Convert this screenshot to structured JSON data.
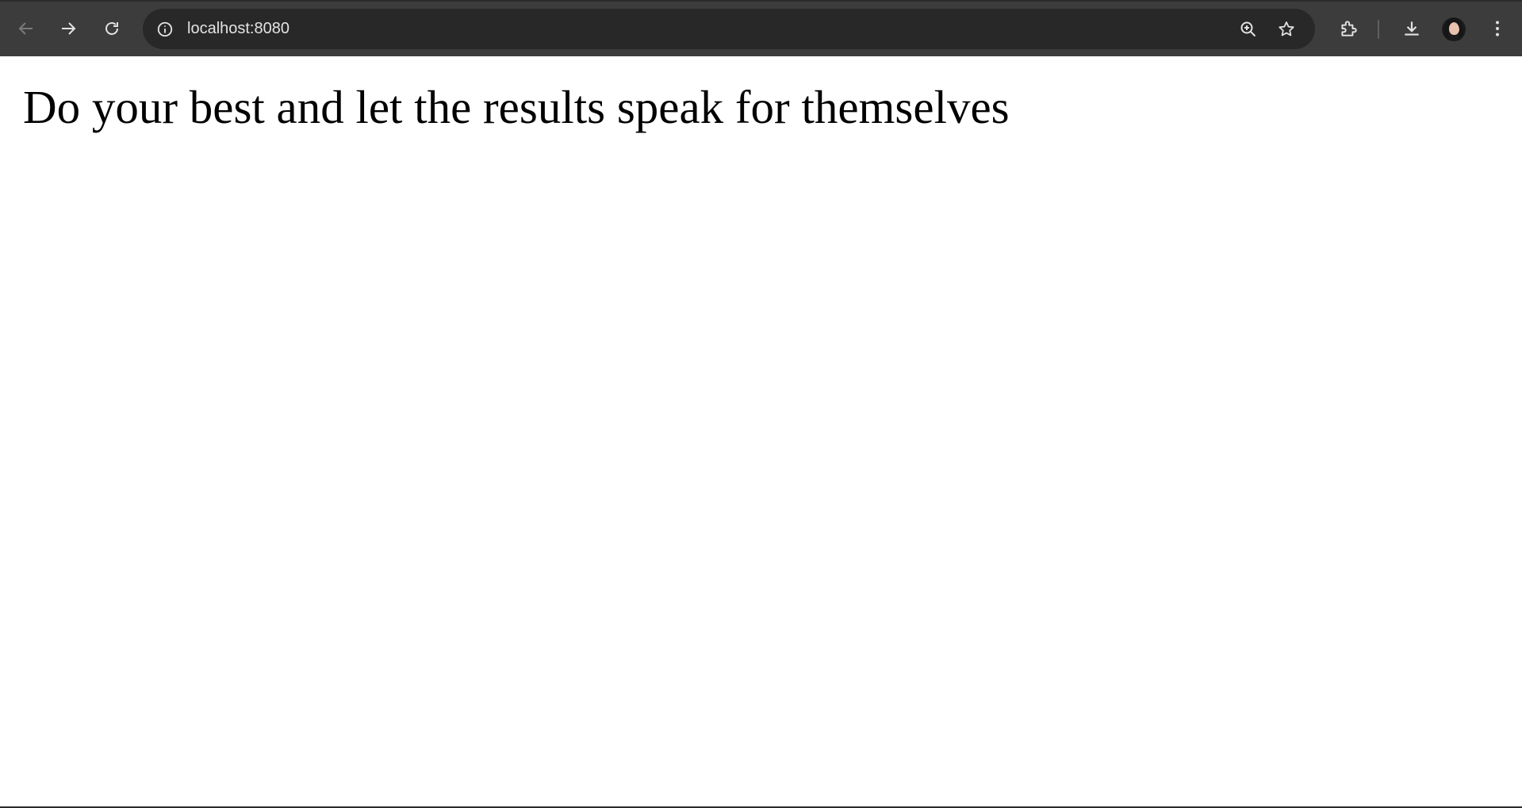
{
  "browser": {
    "url": "localhost:8080",
    "icons": {
      "back": "arrow-left-icon",
      "forward": "arrow-right-icon",
      "reload": "reload-icon",
      "site_info": "info-icon",
      "zoom": "zoom-in-icon",
      "bookmark": "star-icon",
      "extensions": "puzzle-icon",
      "downloads": "download-icon",
      "menu": "kebab-menu-icon"
    },
    "colors": {
      "toolbar": "#3c3c3c",
      "omnibox": "#282828",
      "icon": "#e3e3e3",
      "icon_disabled": "#7a7a7a"
    }
  },
  "page": {
    "heading": "Do your best and let the results speak for themselves",
    "background": "#ffffff",
    "text_color": "#000000"
  }
}
